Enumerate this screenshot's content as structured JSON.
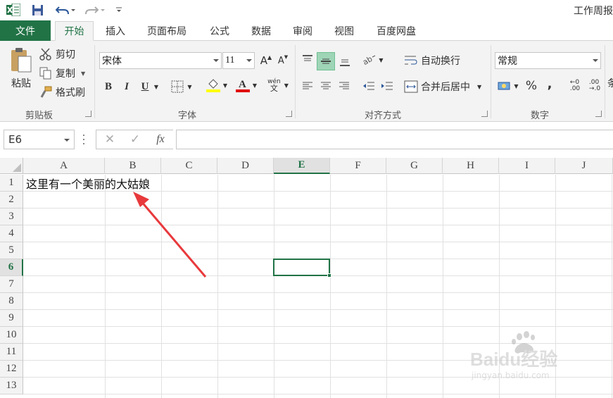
{
  "window": {
    "title": "工作周报"
  },
  "quick_access": {
    "save_icon": "save-icon",
    "undo_icon": "undo-icon",
    "redo_icon": "redo-icon"
  },
  "tabs": [
    {
      "label": "文件"
    },
    {
      "label": "开始"
    },
    {
      "label": "插入"
    },
    {
      "label": "页面布局"
    },
    {
      "label": "公式"
    },
    {
      "label": "数据"
    },
    {
      "label": "审阅"
    },
    {
      "label": "视图"
    },
    {
      "label": "百度网盘"
    }
  ],
  "ribbon": {
    "clipboard": {
      "paste": "粘贴",
      "cut": "剪切",
      "copy": "复制",
      "format_painter": "格式刷",
      "group_label": "剪贴板"
    },
    "font": {
      "name": "宋体",
      "size": "11",
      "bold": "B",
      "italic": "I",
      "underline": "U",
      "group_label": "字体",
      "grow": "A",
      "shrink": "A",
      "pinyin_top": "wén",
      "pinyin_bottom": "文"
    },
    "alignment": {
      "wrap_text": "自动换行",
      "merge_center": "合并后居中",
      "group_label": "对齐方式"
    },
    "number": {
      "format": "常规",
      "percent": "%",
      "comma": ",",
      "inc_dec_1": "←0",
      "inc_dec_2": ".00",
      "dec_dec_1": ".00",
      "dec_dec_2": "→.0",
      "group_label": "数字"
    },
    "styles_partial": "条"
  },
  "formula_bar": {
    "name_box": "E6",
    "cancel": "✕",
    "enter": "✓",
    "fx": "fx",
    "formula": ""
  },
  "sheet": {
    "columns": [
      "A",
      "B",
      "C",
      "D",
      "E",
      "F",
      "G",
      "H",
      "I",
      "J"
    ],
    "rows": [
      "1",
      "2",
      "3",
      "4",
      "5",
      "6",
      "7",
      "8",
      "9",
      "10",
      "11",
      "12",
      "13"
    ],
    "selected_column": "E",
    "selected_row": "6",
    "cells": {
      "A1": "这里有一个美丽的大姑娘"
    }
  },
  "watermark": {
    "brand": "Baidu经验",
    "url": "jingyan.baidu.com"
  },
  "colors": {
    "accent": "#217346",
    "arrow": "#e8393c"
  }
}
